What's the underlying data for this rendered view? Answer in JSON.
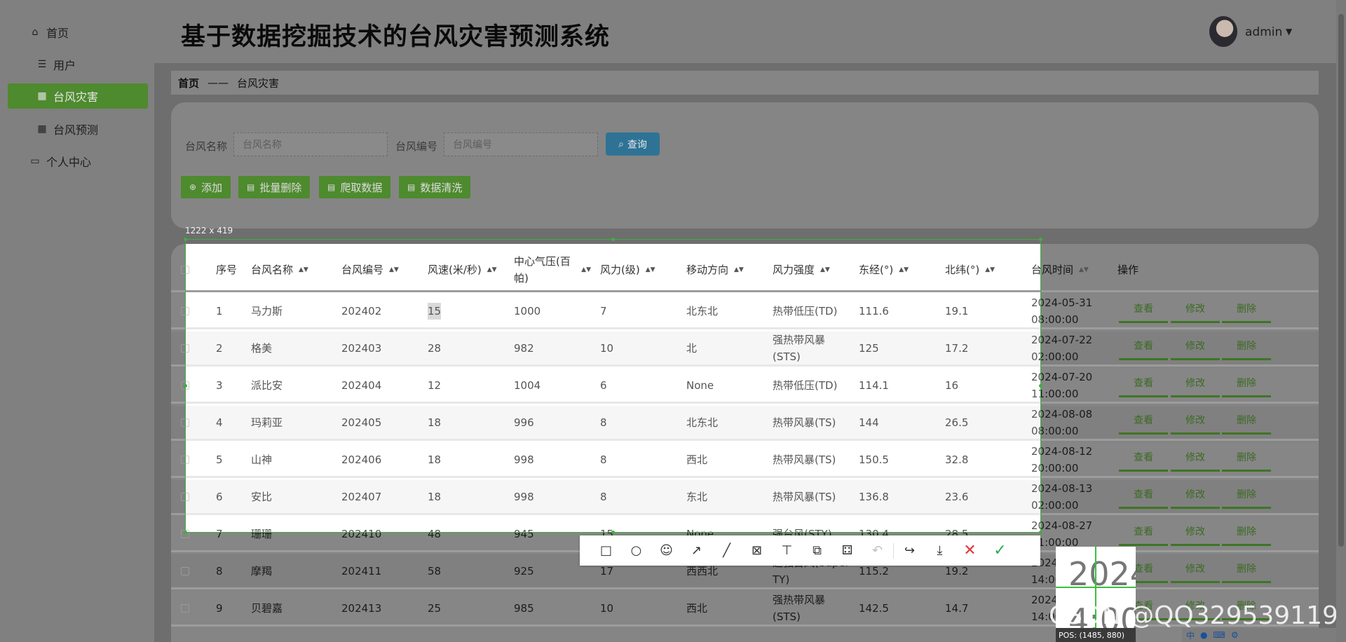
{
  "app": {
    "title": "基于数据挖掘技术的台风灾害预测系统"
  },
  "sidebar": {
    "items": [
      {
        "label": "首页",
        "icon": "home-icon"
      },
      {
        "label": "用户",
        "icon": "sliders-icon"
      },
      {
        "label": "台风灾害",
        "icon": "grid-icon",
        "active": true
      },
      {
        "label": "台风预测",
        "icon": "grid-icon"
      },
      {
        "label": "个人中心",
        "icon": "card-icon"
      }
    ]
  },
  "header": {
    "user": "admin"
  },
  "breadcrumb": {
    "home": "首页",
    "separator": "——",
    "current": "台风灾害"
  },
  "search": {
    "name_label": "台风名称",
    "name_placeholder": "台风名称",
    "code_label": "台风编号",
    "code_placeholder": "台风编号",
    "query_label": "查询"
  },
  "toolbar": {
    "add": "添加",
    "batch_delete": "批量删除",
    "crawl": "爬取数据",
    "clean": "数据清洗"
  },
  "table": {
    "columns": [
      "序号",
      "台风名称",
      "台风编号",
      "风速(米/秒)",
      "中心气压(百帕)",
      "风力(级)",
      "移动方向",
      "风力强度",
      "东经(°)",
      "北纬(°)",
      "台风时间",
      "操作"
    ],
    "actions": {
      "view": "查看",
      "edit": "修改",
      "delete": "删除"
    },
    "rows": [
      [
        "1",
        "马力斯",
        "202402",
        "15",
        "1000",
        "7",
        "北东北",
        "热带低压(TD)",
        "111.6",
        "19.1",
        "2024-05-31 08:00:00"
      ],
      [
        "2",
        "格美",
        "202403",
        "28",
        "982",
        "10",
        "北",
        "强热带风暴(STS)",
        "125",
        "17.2",
        "2024-07-22 02:00:00"
      ],
      [
        "3",
        "派比安",
        "202404",
        "12",
        "1004",
        "6",
        "None",
        "热带低压(TD)",
        "114.1",
        "16",
        "2024-07-20 11:00:00"
      ],
      [
        "4",
        "玛莉亚",
        "202405",
        "18",
        "996",
        "8",
        "北东北",
        "热带风暴(TS)",
        "144",
        "26.5",
        "2024-08-08 08:00:00"
      ],
      [
        "5",
        "山神",
        "202406",
        "18",
        "998",
        "8",
        "西北",
        "热带风暴(TS)",
        "150.5",
        "32.8",
        "2024-08-12 20:00:00"
      ],
      [
        "6",
        "安比",
        "202407",
        "18",
        "998",
        "8",
        "东北",
        "热带风暴(TS)",
        "136.8",
        "23.6",
        "2024-08-13 02:00:00"
      ],
      [
        "7",
        "珊珊",
        "202410",
        "48",
        "945",
        "15",
        "None",
        "强台风(STY)",
        "130.4",
        "28.5",
        "2024-08-27 11:00:00"
      ],
      [
        "8",
        "摩羯",
        "202411",
        "58",
        "925",
        "17",
        "西西北",
        "超强台风(Super TY)",
        "115.2",
        "19.2",
        "2024-09-05 14:00:00"
      ],
      [
        "9",
        "贝碧嘉",
        "202413",
        "25",
        "985",
        "10",
        "西北",
        "强热带风暴(STS)",
        "142.5",
        "14.7",
        "2024-09-12 14:00:00"
      ]
    ]
  },
  "capture": {
    "size_label": "1222 x 419",
    "pos_label": "POS: (1485, 880)",
    "magnifier_top": "2024",
    "magnifier_bottom": "4:00",
    "watermark": "CSDN @QQ3295391197"
  },
  "tray": {
    "ime": "中"
  },
  "colors": {
    "accent": "#4e8a2e",
    "query": "#2e7395",
    "selection": "#3fae3f"
  }
}
